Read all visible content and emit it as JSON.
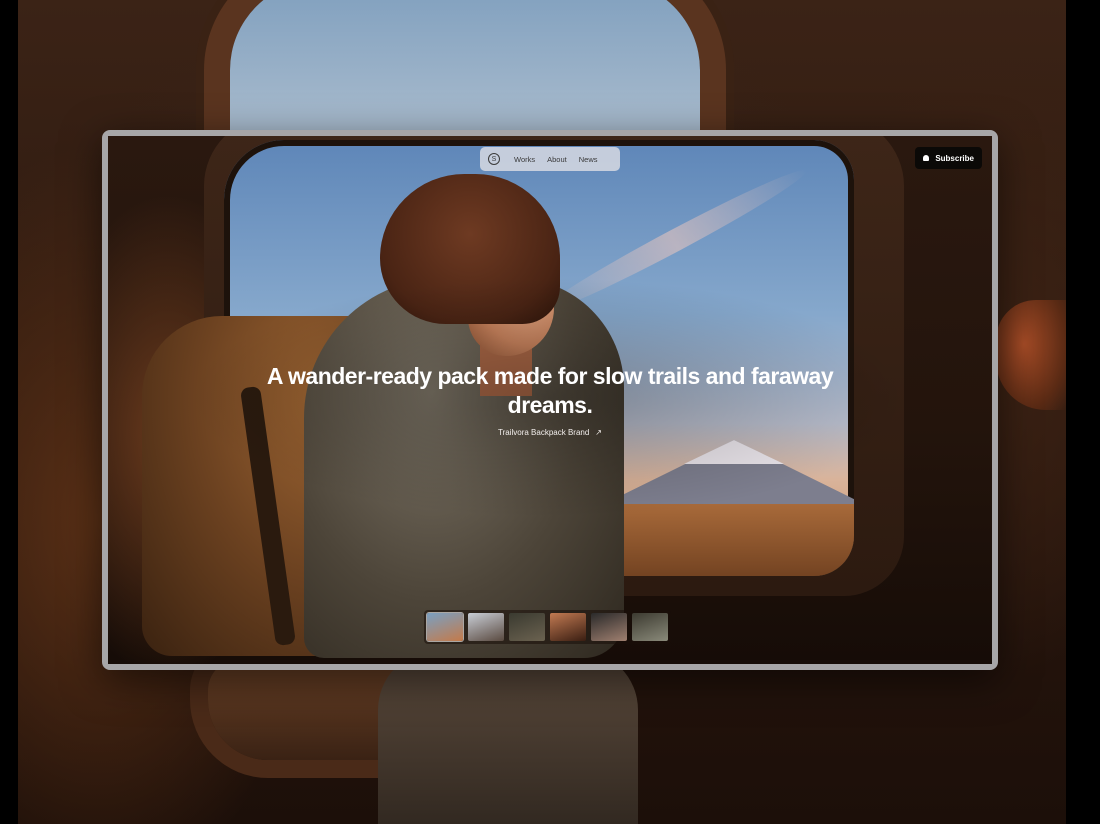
{
  "nav": {
    "logo_glyph": "S",
    "items": [
      "Works",
      "About",
      "News"
    ]
  },
  "subscribe": {
    "label": "Subscribe"
  },
  "hero": {
    "headline": "A wander-ready pack made for slow trails and faraway dreams.",
    "brand_link": "Trailvora Backpack Brand",
    "brand_link_arrow": "↗"
  },
  "thumbnails": [
    {
      "name": "thumb-woman-window",
      "colors": [
        "#7aa0c2",
        "#c47a4a"
      ]
    },
    {
      "name": "thumb-portrait-light",
      "colors": [
        "#c9ced6",
        "#5a4a40"
      ]
    },
    {
      "name": "thumb-forest-figure",
      "colors": [
        "#3a3a30",
        "#6b6250"
      ]
    },
    {
      "name": "thumb-pack-product",
      "colors": [
        "#c27a52",
        "#3a1e12"
      ]
    },
    {
      "name": "thumb-couple",
      "colors": [
        "#2a2a2a",
        "#a08070"
      ]
    },
    {
      "name": "thumb-outdoor-figure",
      "colors": [
        "#3c3a30",
        "#8a8a7a"
      ]
    }
  ],
  "colors": {
    "nav_bg": "#ebe8e9",
    "subscribe_bg": "#0b0907",
    "frame": "#a7a6a8"
  }
}
